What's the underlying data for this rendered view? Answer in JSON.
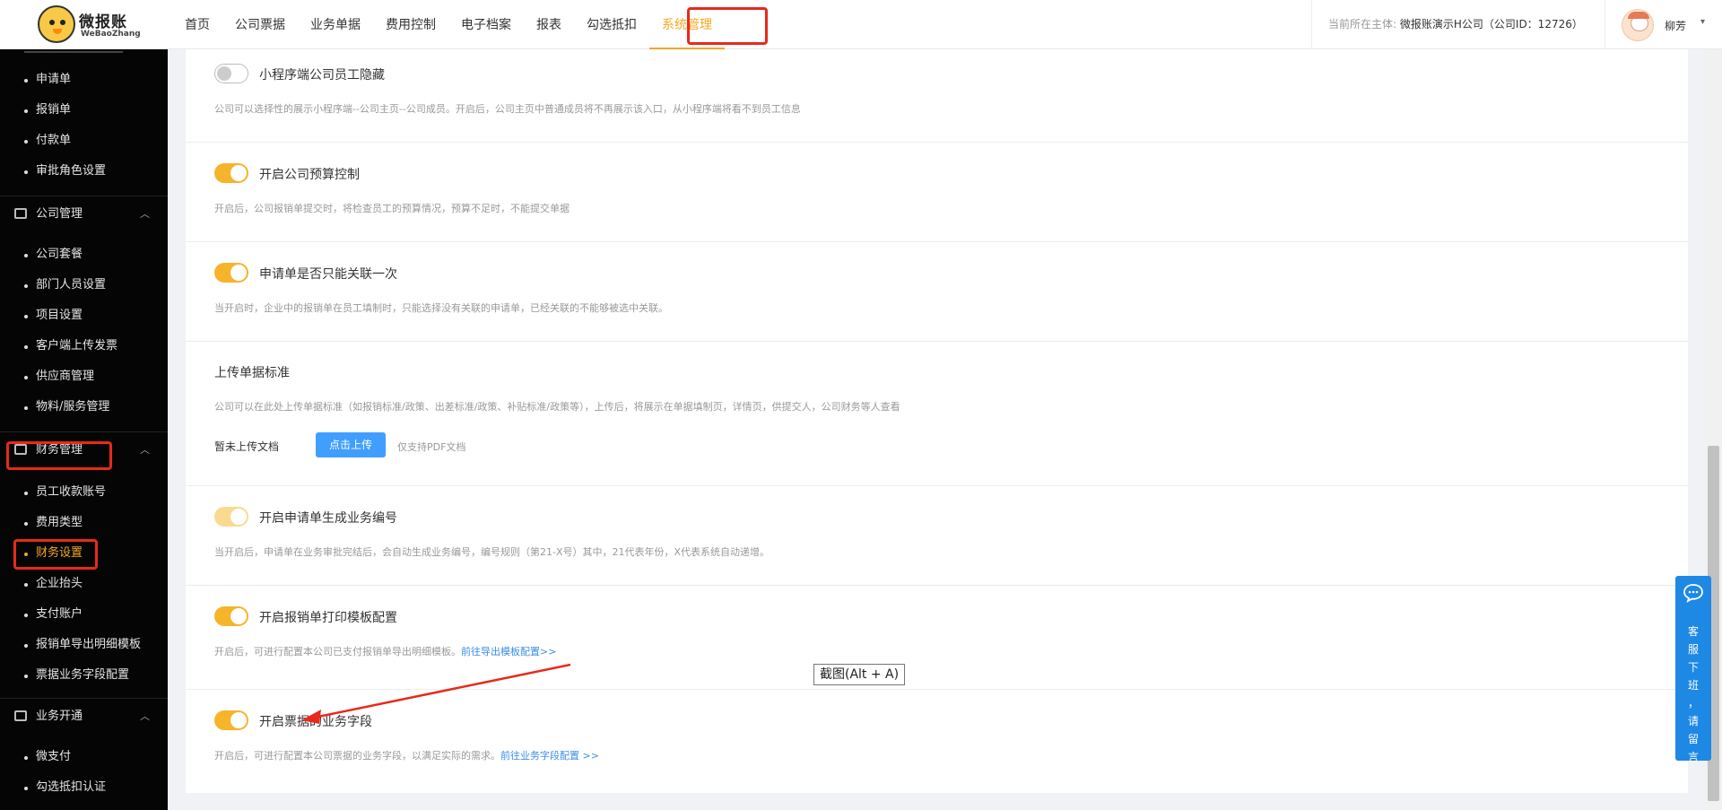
{
  "logo": {
    "name": "微报账",
    "sub": "WeBaoZhang"
  },
  "nav": {
    "items": [
      {
        "label": "首页"
      },
      {
        "label": "公司票据"
      },
      {
        "label": "业务单据"
      },
      {
        "label": "费用控制"
      },
      {
        "label": "电子档案"
      },
      {
        "label": "报表"
      },
      {
        "label": "勾选抵扣"
      },
      {
        "label": "系统管理"
      }
    ],
    "active_index": 7
  },
  "company": {
    "prefix": "当前所在主体:",
    "name": "微报账演示H公司（公司ID：12726）"
  },
  "user": {
    "name": "柳芳",
    "caret": "▾"
  },
  "sidebar": {
    "top_items": [
      {
        "label": "申请单"
      },
      {
        "label": "报销单"
      },
      {
        "label": "付款单"
      },
      {
        "label": "审批角色设置"
      }
    ],
    "groups": [
      {
        "label": "公司管理",
        "chevron": "︿",
        "items": [
          {
            "label": "公司套餐"
          },
          {
            "label": "部门人员设置"
          },
          {
            "label": "项目设置"
          },
          {
            "label": "客户端上传发票"
          },
          {
            "label": "供应商管理"
          },
          {
            "label": "物料/服务管理"
          }
        ]
      },
      {
        "label": "财务管理",
        "chevron": "︿",
        "items": [
          {
            "label": "员工收款账号"
          },
          {
            "label": "费用类型"
          },
          {
            "label": "财务设置",
            "active": true
          },
          {
            "label": "企业抬头"
          },
          {
            "label": "支付账户"
          },
          {
            "label": "报销单导出明细模板"
          },
          {
            "label": "票据业务字段配置"
          }
        ]
      },
      {
        "label": "业务开通",
        "chevron": "︿",
        "items": [
          {
            "label": "微支付"
          },
          {
            "label": "勾选抵扣认证"
          }
        ]
      }
    ]
  },
  "settings": [
    {
      "title": "小程序端公司员工隐藏",
      "toggle": "off",
      "desc": "公司可以选择性的展示小程序端--公司主页--公司成员。开启后，公司主页中普通成员将不再展示该入口，从小程序端将看不到员工信息"
    },
    {
      "title": "开启公司预算控制",
      "toggle": "on",
      "desc": "开启后，公司报销单提交时，将检查员工的预算情况，预算不足时，不能提交单据"
    },
    {
      "title": "申请单是否只能关联一次",
      "toggle": "on",
      "desc": "当开启时，企业中的报销单在员工填制时，只能选择没有关联的申请单，已经关联的不能够被选中关联。"
    },
    {
      "title": "上传单据标准",
      "toggle": "none",
      "desc": "公司可以在此处上传单据标准（如报销标准/政策、出差标准/政策、补贴标准/政策等），上传后，将展示在单据填制页，详情页，供提交人，公司财务等人查看",
      "upload_label": "暂未上传文档",
      "upload_button": "点击上传",
      "upload_hint": "仅支持PDF文档"
    },
    {
      "title": "开启申请单生成业务编号",
      "toggle": "light",
      "desc": "当开启后，申请单在业务审批完结后，会自动生成业务编号，编号规则（第21-X号）其中，21代表年份，X代表系统自动递增。"
    },
    {
      "title": "开启报销单打印模板配置",
      "toggle": "on",
      "desc": "开启后，可进行配置本公司已支付报销单导出明细模板。",
      "link": "前往导出模板配置>>"
    },
    {
      "title": "开启票据的业务字段",
      "toggle": "on",
      "desc": "开启后，可进行配置本公司票据的业务字段，以满足实际的需求。",
      "link": "前往业务字段配置 >>"
    }
  ],
  "tooltip": "截图(Alt + A)",
  "service": {
    "text": "客服下班，请留言"
  },
  "colors": {
    "accent": "#f5a623",
    "highlight": "#e8291b",
    "primary": "#409eff",
    "sidebar_bg": "#050505"
  }
}
